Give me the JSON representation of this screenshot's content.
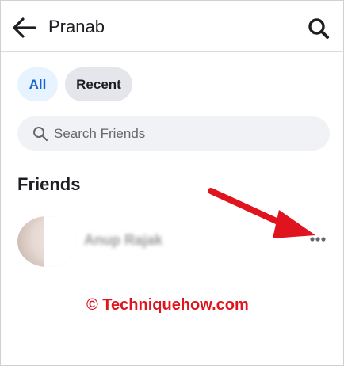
{
  "header": {
    "title": "Pranab",
    "back_icon": "arrow-left-icon",
    "search_icon": "search-icon"
  },
  "filters": [
    {
      "label": "All",
      "selected": true
    },
    {
      "label": "Recent",
      "selected": false
    }
  ],
  "search": {
    "placeholder": "Search Friends",
    "value": "",
    "icon": "search-icon"
  },
  "section": {
    "title": "Friends"
  },
  "friends": [
    {
      "name": "Anup Rajak",
      "avatar": "avatar",
      "more_icon": "more-dots-icon"
    }
  ],
  "annotation": {
    "arrow_color": "#e0141e"
  },
  "watermark": "© Techniquehow.com",
  "colors": {
    "accent": "#1763cf",
    "chip_selected_bg": "#e7f3ff",
    "chip_bg": "#e4e6eb",
    "search_bg": "#f0f2f5",
    "watermark": "#e0141e"
  }
}
